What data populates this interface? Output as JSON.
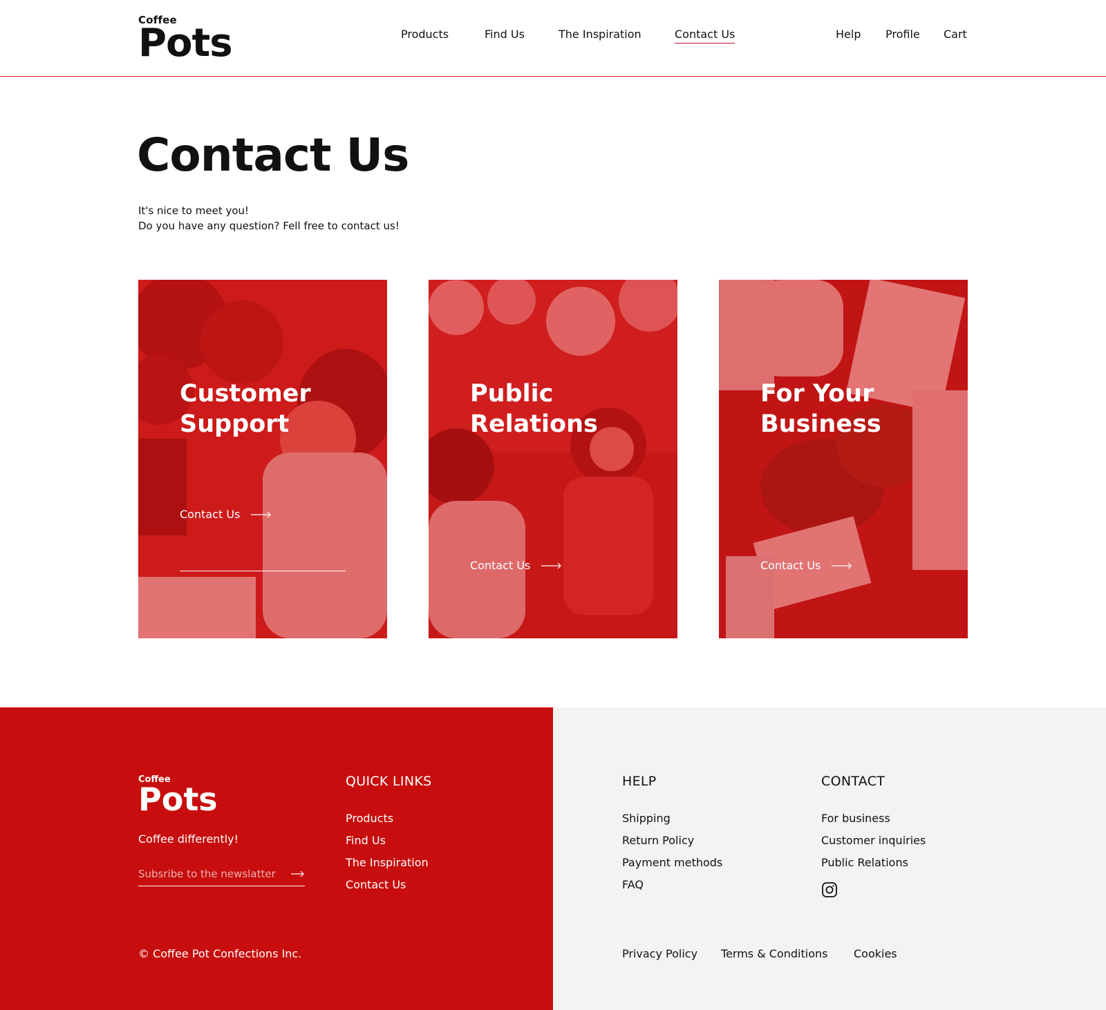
{
  "header": {
    "logo_small": "Coffee",
    "logo_big": "Pots",
    "nav": [
      {
        "label": "Products"
      },
      {
        "label": "Find Us"
      },
      {
        "label": "The Inspiration"
      },
      {
        "label": "Contact Us"
      }
    ],
    "utility": [
      {
        "label": "Help"
      },
      {
        "label": "Profile"
      },
      {
        "label": "Cart"
      }
    ]
  },
  "main": {
    "title": "Contact Us",
    "intro_line1": "It's nice to meet you!",
    "intro_line2": "Do you have any question? Fell free to contact us!",
    "cards": [
      {
        "title_line1": "Customer",
        "title_line2": "Support",
        "cta": "Contact Us"
      },
      {
        "title_line1": "Public",
        "title_line2": "Relations",
        "cta": "Contact Us"
      },
      {
        "title_line1": "For Your",
        "title_line2": "Business",
        "cta": "Contact Us"
      }
    ]
  },
  "footer": {
    "logo_small": "Coffee",
    "logo_big": "Pots",
    "tagline": "Coffee differently!",
    "newsletter_placeholder": "Subsribe to the newslatter",
    "copyright": "© Coffee Pot Confections Inc.",
    "quick_links": {
      "title": "QUICK LINKS",
      "items": [
        "Products",
        "Find Us",
        "The Inspiration",
        "Contact Us"
      ]
    },
    "help": {
      "title": "HELP",
      "items": [
        "Shipping",
        "Return Policy",
        "Payment methods",
        "FAQ"
      ]
    },
    "contact": {
      "title": "CONTACT",
      "items": [
        "For business",
        "Customer inquiries",
        "Public Relations"
      ],
      "social_icon": "instagram-icon"
    },
    "legal": [
      "Privacy Policy",
      "Terms & Conditions",
      "Cookies"
    ]
  },
  "colors": {
    "brand_red": "#c70d0d",
    "accent_line": "#c8102e",
    "footer_grey": "#f3f3f3"
  }
}
